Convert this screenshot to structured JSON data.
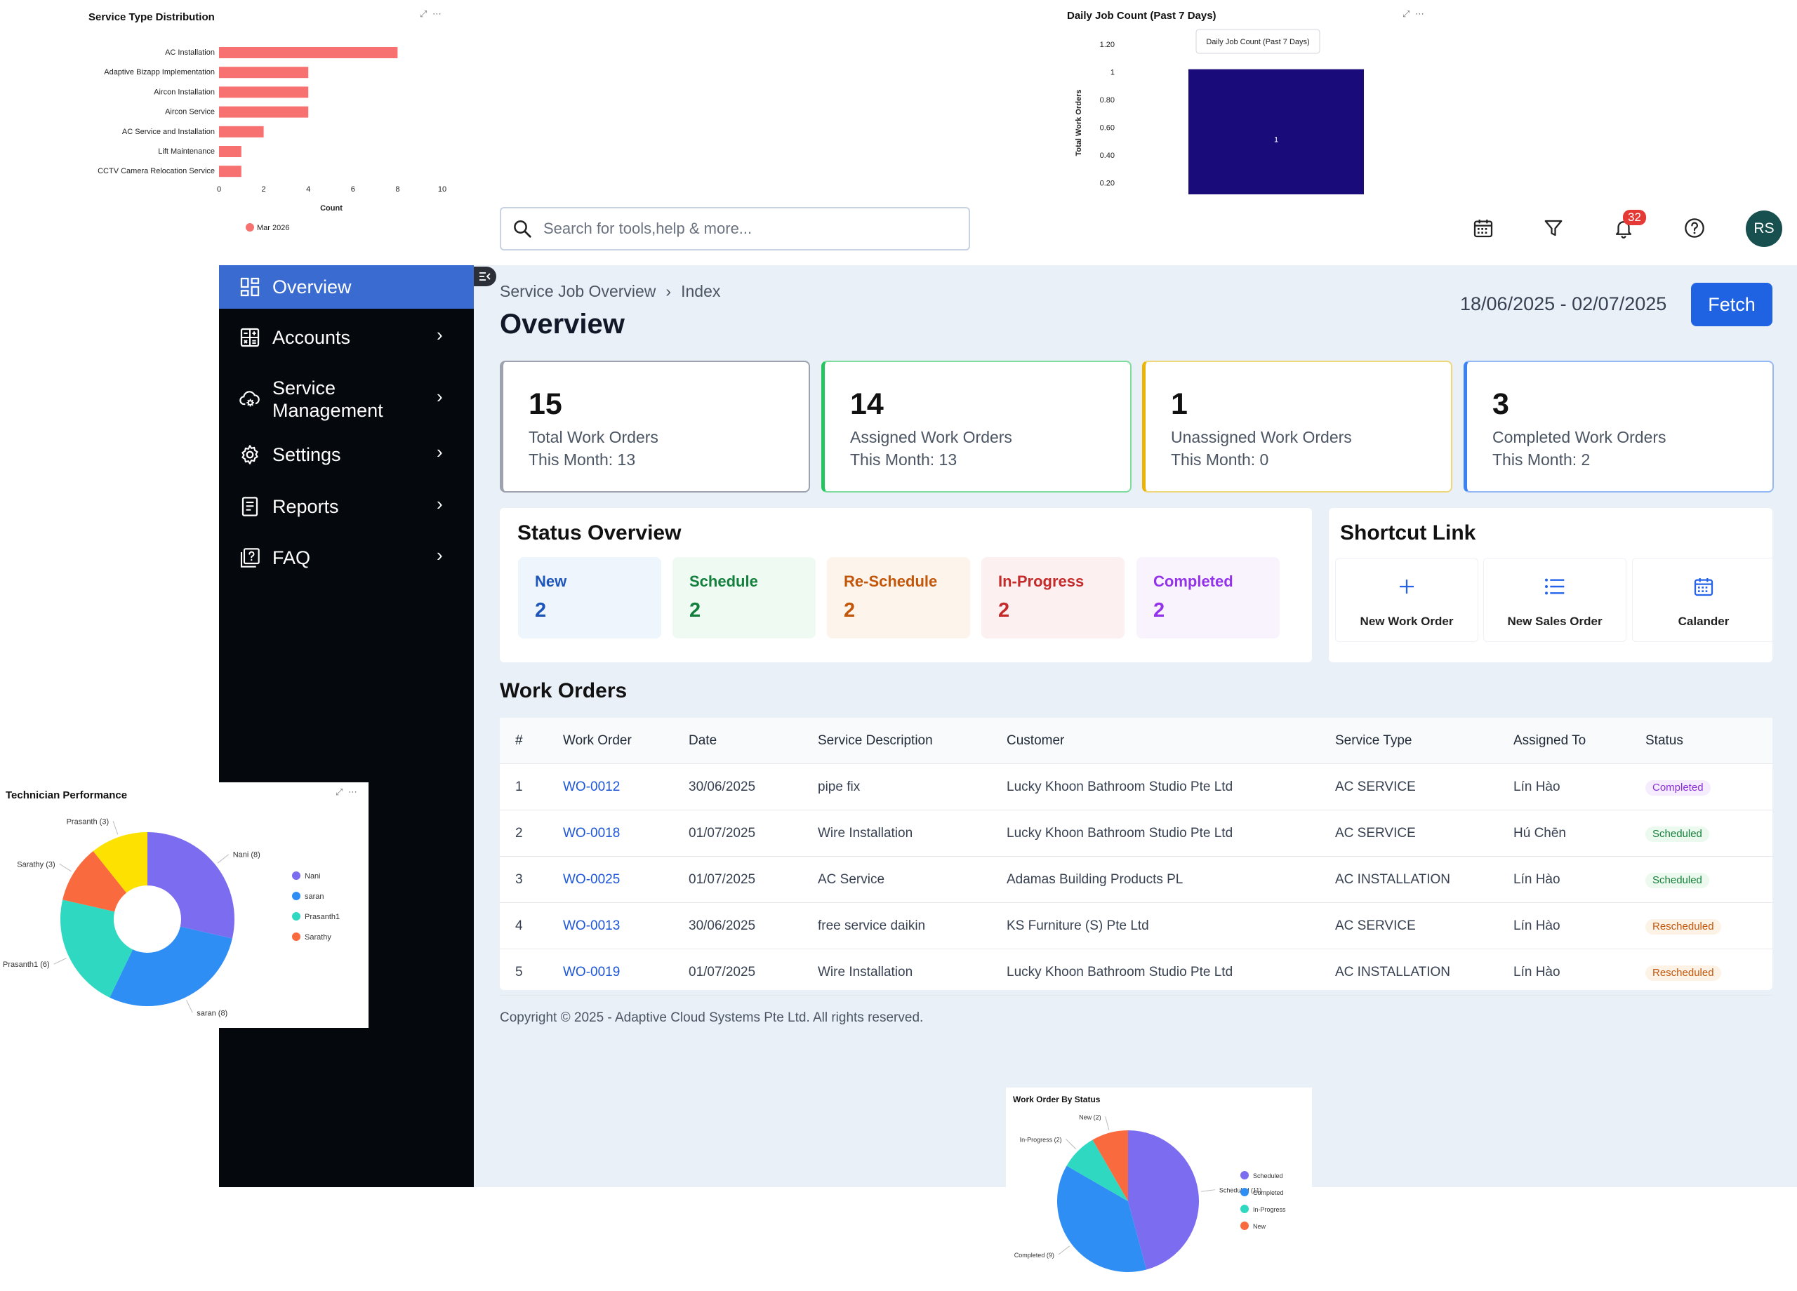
{
  "service_type_chart": {
    "title": "Service Type Distribution",
    "tools": "⤢ ⋯",
    "chart_data": {
      "type": "bar",
      "orientation": "horizontal",
      "categories": [
        "AC Installation",
        "Adaptive Bizapp Implementation",
        "Aircon Installation",
        "Aircon Service",
        "AC Service and Installation",
        "Lift Maintenance",
        "CCTV Camera Relocation Service"
      ],
      "series": [
        {
          "name": "Mar 2026",
          "values": [
            8,
            4,
            4,
            4,
            2,
            1,
            1
          ],
          "color": "#f87171"
        }
      ],
      "xlabel": "Count",
      "xlim": [
        0,
        10
      ],
      "xticks": [
        "0",
        "2",
        "4",
        "6",
        "8",
        "10"
      ],
      "legend": "bottom-left"
    }
  },
  "daily_job_chart": {
    "title": "Daily Job Count (Past 7 Days)",
    "tools": "⤢ ⋯",
    "tooltip": "Daily Job Count (Past 7 Days)",
    "chart_data": {
      "type": "bar",
      "ylabel": "Total Work Orders",
      "yticks": [
        "1.20",
        "1",
        "0.80",
        "0.60",
        "0.40",
        "0.20"
      ],
      "series": [
        {
          "values": [
            1
          ],
          "labels": [
            "1"
          ],
          "color": "#1a0b7a"
        }
      ]
    }
  },
  "technician_chart": {
    "title": "Technician Performance",
    "tools": "⤢ ⋯",
    "chart_data": {
      "type": "pie",
      "style": "donut",
      "labels": [
        "Nani",
        "saran",
        "Prasanth1",
        "Sarathy",
        "Prasanth"
      ],
      "values": [
        8,
        8,
        6,
        3,
        3
      ],
      "slice_labels": [
        "Nani (8)",
        "saran (8)",
        "Prasanth1 (6)",
        "Sarathy (3)",
        "Prasanth (3)"
      ],
      "colors": [
        "#7c6cf0",
        "#2f8ef4",
        "#2fd9c1",
        "#fa6a3f",
        "#fde100"
      ],
      "legend": [
        "Nani",
        "saran",
        "Prasanth1",
        "Sarathy"
      ]
    }
  },
  "status_chart": {
    "title": "Work Order By Status",
    "chart_data": {
      "type": "pie",
      "labels": [
        "Scheduled",
        "Completed",
        "In-Progress",
        "New"
      ],
      "values": [
        11,
        9,
        2,
        2
      ],
      "slice_labels": [
        "Scheduled (11)",
        "Completed (9)",
        "In-Progress (2)",
        "New (2)"
      ],
      "colors": [
        "#7c6cf0",
        "#2f8ef4",
        "#2fd9c1",
        "#fa6a3f"
      ],
      "legend": [
        "Scheduled",
        "Completed",
        "In-Progress",
        "New"
      ]
    }
  },
  "header": {
    "search_placeholder": "Search for tools,help & more...",
    "notification_count": "32",
    "avatar_initials": "RS"
  },
  "sidebar": {
    "items": [
      {
        "label": "Overview",
        "icon": "dashboard-icon",
        "active": true
      },
      {
        "label": "Accounts",
        "icon": "calculator-icon",
        "chevron": "›"
      },
      {
        "label": "Service\nManagement",
        "icon": "cloud-gear-icon",
        "chevron": "›"
      },
      {
        "label": "Settings",
        "icon": "gear-icon",
        "chevron": "›"
      },
      {
        "label": "Reports",
        "icon": "report-icon",
        "chevron": "›"
      },
      {
        "label": "FAQ",
        "icon": "faq-icon",
        "chevron": "›"
      }
    ]
  },
  "main": {
    "breadcrumb": [
      "Service Job Overview",
      "Index"
    ],
    "breadcrumb_sep": "›",
    "title": "Overview",
    "date_range": "18/06/2025 - 02/07/2025",
    "fetch_label": "Fetch",
    "kpis": [
      {
        "value": "15",
        "label": "Total Work Orders",
        "sub": "This Month: 13",
        "color": "#6b7280"
      },
      {
        "value": "14",
        "label": "Assigned Work Orders",
        "sub": "This Month: 13",
        "color": "#22c55e"
      },
      {
        "value": "1",
        "label": "Unassigned Work Orders",
        "sub": "This Month: 0",
        "color": "#eab308"
      },
      {
        "value": "3",
        "label": "Completed Work Orders",
        "sub": "This Month: 2",
        "color": "#3b82f6"
      }
    ],
    "status_overview": {
      "title": "Status Overview",
      "tiles": [
        {
          "label": "New",
          "value": "2",
          "bg": "#eef5fd",
          "fg": "#1d56b8"
        },
        {
          "label": "Schedule",
          "value": "2",
          "bg": "#eefaf2",
          "fg": "#15803d"
        },
        {
          "label": "Re-Schedule",
          "value": "2",
          "bg": "#fdf4ec",
          "fg": "#c2570c"
        },
        {
          "label": "In-Progress",
          "value": "2",
          "bg": "#fdf0f0",
          "fg": "#c42b2b"
        },
        {
          "label": "Completed",
          "value": "2",
          "bg": "#f9f3fd",
          "fg": "#9333ea"
        }
      ]
    },
    "shortcuts": {
      "title": "Shortcut Link",
      "items": [
        {
          "label": "New Work Order",
          "icon": "plus-icon"
        },
        {
          "label": "New Sales Order",
          "icon": "list-icon"
        },
        {
          "label": "Calander",
          "icon": "calendar-icon"
        }
      ]
    },
    "work_orders": {
      "title": "Work Orders",
      "columns": [
        "#",
        "Work Order",
        "Date",
        "Service Description",
        "Customer",
        "Service Type",
        "Assigned To",
        "Status"
      ],
      "rows": [
        [
          "1",
          "WO-0012",
          "30/06/2025",
          "pipe fix",
          "Lucky Khoon Bathroom Studio Pte Ltd",
          "AC SERVICE",
          "Lín Hào",
          "Completed"
        ],
        [
          "2",
          "WO-0018",
          "01/07/2025",
          "Wire Installation",
          "Lucky Khoon Bathroom Studio Pte Ltd",
          "AC SERVICE",
          "Hú Chēn",
          "Scheduled"
        ],
        [
          "3",
          "WO-0025",
          "01/07/2025",
          "AC Service",
          "Adamas Building Products PL",
          "AC INSTALLATION",
          "Lín Hào",
          "Scheduled"
        ],
        [
          "4",
          "WO-0013",
          "30/06/2025",
          "free service daikin",
          "KS Furniture (S) Pte Ltd",
          "AC SERVICE",
          "Lín Hào",
          "Rescheduled"
        ],
        [
          "5",
          "WO-0019",
          "01/07/2025",
          "Wire Installation",
          "Lucky Khoon Bathroom Studio Pte Ltd",
          "AC INSTALLATION",
          "Lín Hào",
          "Rescheduled"
        ]
      ],
      "status_colors": {
        "Completed": {
          "bg": "#f5edfd",
          "fg": "#8b2fd6"
        },
        "Scheduled": {
          "bg": "#ebf9ef",
          "fg": "#16803a"
        },
        "Rescheduled": {
          "bg": "#fdf2e6",
          "fg": "#c2570c"
        }
      }
    },
    "copyright": "Copyright © 2025 - Adaptive Cloud Systems Pte Ltd. All rights reserved."
  }
}
